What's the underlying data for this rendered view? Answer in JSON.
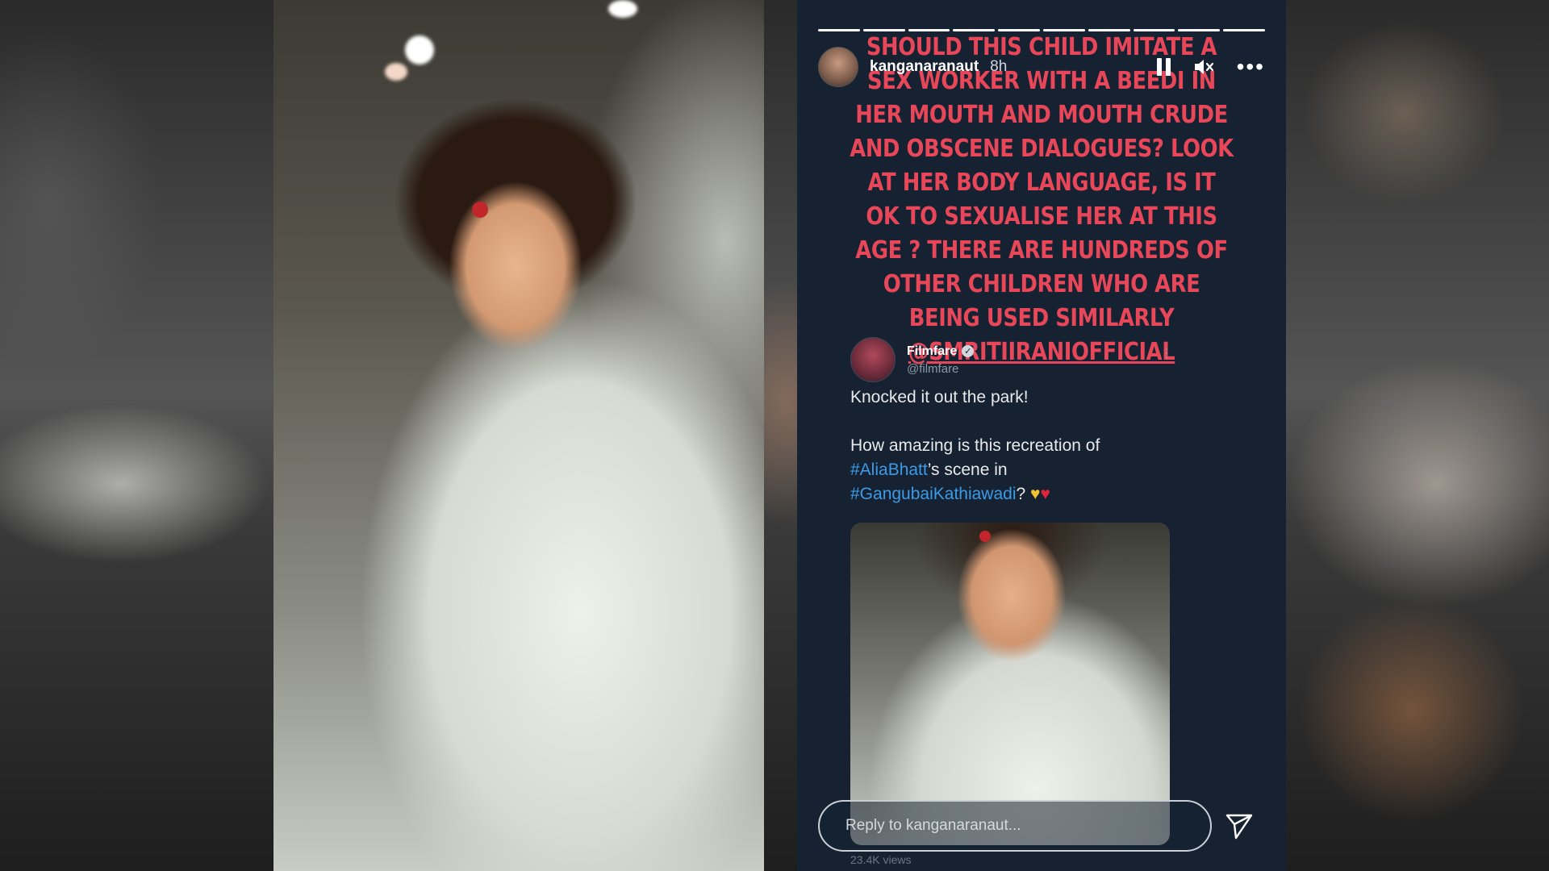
{
  "story": {
    "username": "kanganaranaut",
    "time": "8h",
    "progress": {
      "segments": 10,
      "completed": 10
    },
    "headline": "SHOULD THIS CHILD IMITATE A SEX WORKER WITH A BEEDI IN HER MOUTH AND MOUTH CRUDE AND OBSCENE DIALOGUES?  LOOK AT HER BODY LANGUAGE, IS IT OK TO SEXUALISE HER AT THIS AGE ? THERE ARE HUNDREDS OF OTHER CHILDREN WHO ARE BEING USED SIMILARLY",
    "headline_mention": "@SMRITIIRANIOFFICIAL",
    "headline_color": "#e8475a",
    "tweet": {
      "name": "Filmfare",
      "handle": "@filmfare",
      "line1": "Knocked it out the park!",
      "line2_prefix": "How amazing is this recreation of",
      "hashtag1": "#AliaBhatt",
      "line2_mid": "’s scene in",
      "hashtag2": "#GangubaiKathiawadi",
      "line2_suffix": "?",
      "hashtag_color": "#3b9be8"
    },
    "reply_placeholder": "Reply to kanganaranaut...",
    "views": "23.4K views",
    "icons": {
      "pause": "pause-icon",
      "mute": "speaker-muted-icon",
      "more": "more-horizontal-icon",
      "send": "send-icon",
      "verified": "verified-badge-icon"
    }
  }
}
